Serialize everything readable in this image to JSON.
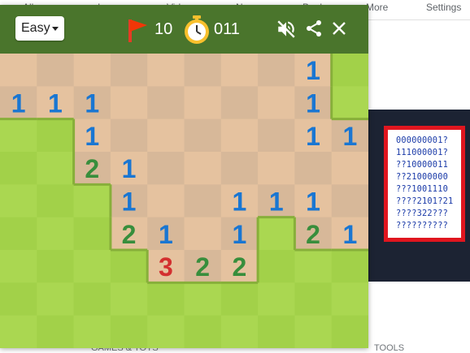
{
  "background": {
    "tabs": [
      "All",
      "Images",
      "Videos",
      "News",
      "Books",
      "More"
    ],
    "settings": "Settings",
    "footer_left": "GAMES & TOYS",
    "footer_right": "TOOLS"
  },
  "game": {
    "difficulty": "Easy",
    "flags": "10",
    "timer": "011",
    "icons": {
      "flag": "flag-icon",
      "timer": "stopwatch-icon",
      "mute": "volume-off-icon",
      "share": "share-icon",
      "close": "close-icon"
    },
    "colors": {
      "topbar": "#4a752c",
      "grass_light": "#aad751",
      "grass_dark": "#a2d149",
      "dirt_light": "#e5c29f",
      "dirt_dark": "#d7b899",
      "border": "#87af3a",
      "num1": "#1976d2",
      "num2": "#388e3c",
      "num3": "#d32f2f"
    },
    "board": [
      "00000001?",
      "111000001?",
      "??10000011",
      "??21000000",
      "???1001110",
      "????2101?21",
      "????322???",
      "??????????"
    ],
    "grid": [
      [
        "0",
        "0",
        "0",
        "0",
        "0",
        "0",
        "0",
        "0",
        "1",
        "?"
      ],
      [
        "1",
        "1",
        "1",
        "0",
        "0",
        "0",
        "0",
        "0",
        "1",
        "?"
      ],
      [
        "?",
        "?",
        "1",
        "0",
        "0",
        "0",
        "0",
        "0",
        "1",
        "1"
      ],
      [
        "?",
        "?",
        "2",
        "1",
        "0",
        "0",
        "0",
        "0",
        "0",
        "0"
      ],
      [
        "?",
        "?",
        "?",
        "1",
        "0",
        "0",
        "1",
        "1",
        "1",
        "0"
      ],
      [
        "?",
        "?",
        "?",
        "2",
        "1",
        "0",
        "1",
        "?",
        "2",
        "1"
      ],
      [
        "?",
        "?",
        "?",
        "?",
        "3",
        "2",
        "2",
        "?",
        "?",
        "?"
      ],
      [
        "?",
        "?",
        "?",
        "?",
        "?",
        "?",
        "?",
        "?",
        "?",
        "?"
      ],
      [
        "?",
        "?",
        "?",
        "?",
        "?",
        "?",
        "?",
        "?",
        "?",
        "?"
      ]
    ]
  },
  "side_panel": {
    "lines": [
      "000000001?",
      "111000001?",
      "??10000011",
      "??21000000",
      "???1001110",
      "????2101?21",
      "????322???",
      "??????????"
    ]
  }
}
